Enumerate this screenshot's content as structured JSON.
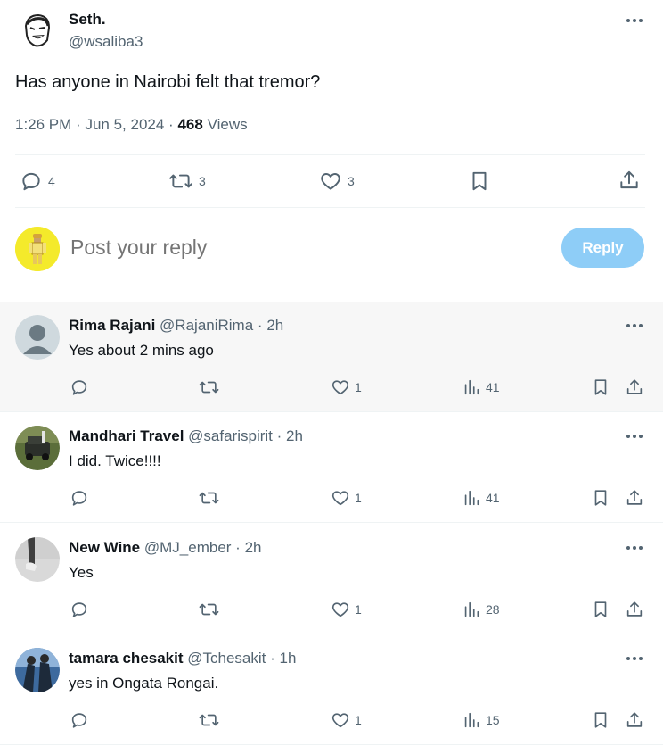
{
  "tweet": {
    "author_name": "Seth.",
    "author_handle": "@wsaliba3",
    "text": "Has anyone in Nairobi felt that tremor?",
    "time": "1:26 PM",
    "date": "Jun 5, 2024",
    "views_count": "468",
    "views_label": "Views",
    "stats": {
      "replies": "4",
      "reposts": "3",
      "likes": "3"
    }
  },
  "compose": {
    "placeholder": "Post your reply",
    "button_label": "Reply"
  },
  "replies": [
    {
      "name": "Rima Rajani",
      "handle": "@RajaniRima",
      "age": "2h",
      "text": "Yes about 2 mins ago",
      "likes": "1",
      "views": "41"
    },
    {
      "name": "Mandhari Travel",
      "handle": "@safarispirit",
      "age": "2h",
      "text": "I did. Twice!!!!",
      "likes": "1",
      "views": "41"
    },
    {
      "name": "New Wine",
      "handle": "@MJ_ember",
      "age": "2h",
      "text": "Yes",
      "likes": "1",
      "views": "28"
    },
    {
      "name": "tamara chesakit",
      "handle": "@Tchesakit",
      "age": "1h",
      "text": "yes in Ongata Rongai.",
      "likes": "1",
      "views": "15"
    }
  ],
  "separator": "·",
  "colors": {
    "muted": "#536471",
    "accent": "#8ecdf7",
    "text": "#0f1419",
    "highlight_bg": "#f7f7f7"
  }
}
